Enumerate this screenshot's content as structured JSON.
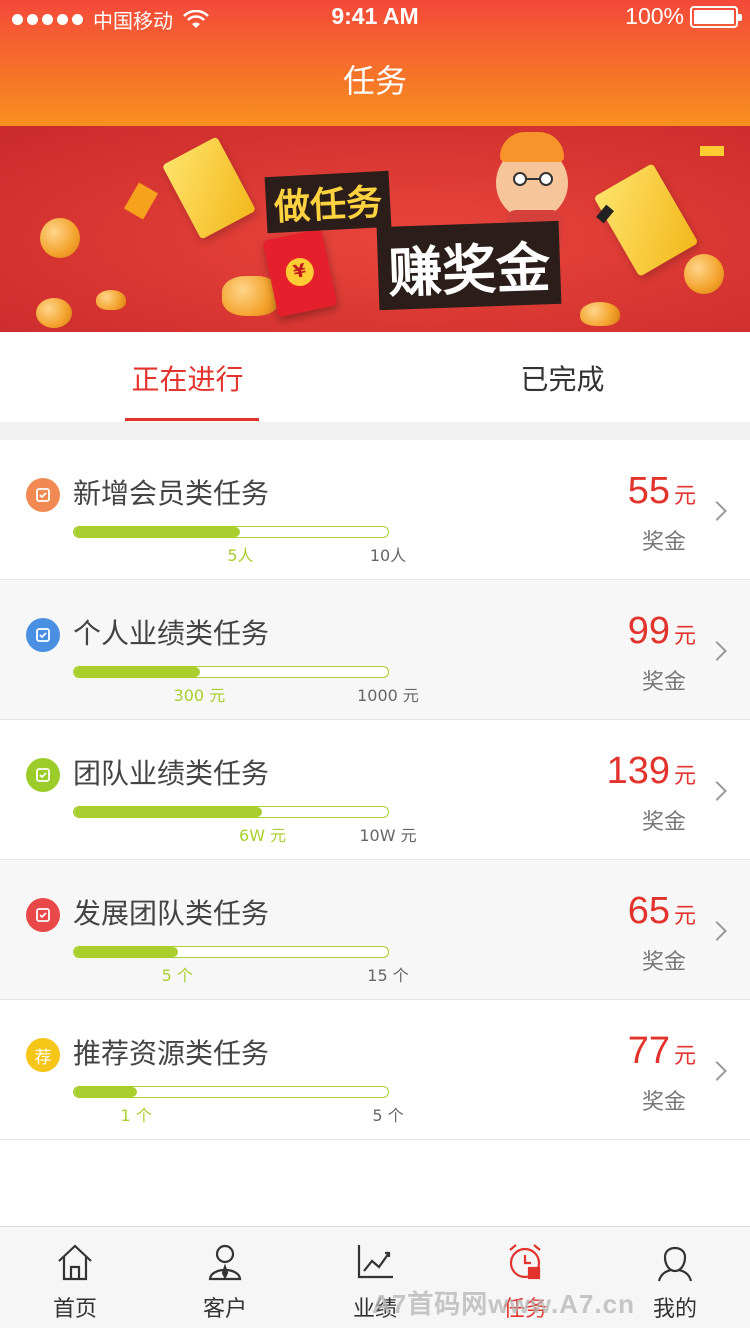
{
  "status_bar": {
    "carrier": "中国移动",
    "time": "9:41 AM",
    "battery": "100%"
  },
  "header": {
    "title": "任务"
  },
  "banner": {
    "line1": "做任务",
    "line2": "赚奖金",
    "envelope_symbol": "¥"
  },
  "tabs": [
    {
      "label": "正在进行",
      "active": true
    },
    {
      "label": "已完成",
      "active": false
    }
  ],
  "tasks": [
    {
      "name": "新增会员类任务",
      "icon": "shield-check-icon",
      "icon_color": "#f08a52",
      "progress": 0.53,
      "current": "5人",
      "target": "10人",
      "amount": "55",
      "unit": "元",
      "reward_label": "奖金"
    },
    {
      "name": "个人业绩类任务",
      "icon": "document-list-icon",
      "icon_color": "#4a90e2",
      "progress": 0.4,
      "current": "300 元",
      "target": "1000 元",
      "amount": "99",
      "unit": "元",
      "reward_label": "奖金"
    },
    {
      "name": "团队业绩类任务",
      "icon": "team-icon",
      "icon_color": "#9ccc2a",
      "progress": 0.6,
      "current": "6W 元",
      "target": "10W 元",
      "amount": "139",
      "unit": "元",
      "reward_label": "奖金"
    },
    {
      "name": "发展团队类任务",
      "icon": "trend-chart-icon",
      "icon_color": "#e84848",
      "progress": 0.33,
      "current": "5 个",
      "target": "15 个",
      "amount": "65",
      "unit": "元",
      "reward_label": "奖金"
    },
    {
      "name": "推荐资源类任务",
      "icon": "recommend-badge-icon",
      "icon_color": "#f5c518",
      "icon_text": "荐",
      "progress": 0.2,
      "current": "1 个",
      "target": "5 个",
      "amount": "77",
      "unit": "元",
      "reward_label": "奖金"
    }
  ],
  "nav": [
    {
      "label": "首页",
      "icon": "home-icon",
      "active": false
    },
    {
      "label": "客户",
      "icon": "customer-icon",
      "active": false
    },
    {
      "label": "业绩",
      "icon": "chart-icon",
      "active": false
    },
    {
      "label": "任务",
      "icon": "alarm-clock-icon",
      "active": true
    },
    {
      "label": "我的",
      "icon": "profile-icon",
      "active": false
    }
  ],
  "watermark": "A7首码网www.A7.cn",
  "colors": {
    "accent": "#e2342d",
    "progress": "#a9cf2e",
    "header_top": "#f4493a",
    "header_bottom": "#f8901f"
  }
}
